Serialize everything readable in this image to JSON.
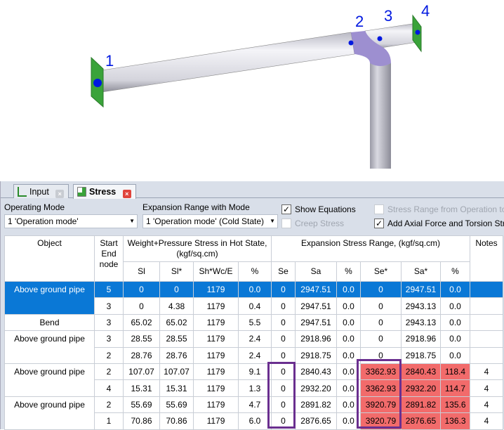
{
  "viewport": {
    "node_labels": [
      "1",
      "2",
      "3",
      "4"
    ]
  },
  "tabs": [
    {
      "label": "Input",
      "active": false
    },
    {
      "label": "Stress",
      "active": true
    }
  ],
  "controls": {
    "operating_mode_label": "Operating Mode",
    "operating_mode_value": "1 'Operation mode'",
    "expansion_label": "Expansion Range with Mode",
    "expansion_value": "1 'Operation mode' (Cold State)",
    "show_equations": {
      "label": "Show Equations",
      "checked": true
    },
    "creep_stress": {
      "label": "Creep Stress",
      "checked": false
    },
    "stress_range": {
      "label": "Stress Range from Operation to",
      "checked": false
    },
    "add_axial": {
      "label": "Add Axial Force and Torsion Stre",
      "checked": true
    }
  },
  "table": {
    "headers": {
      "object": "Object",
      "node": "Start End node",
      "wp": "Weight+Pressure Stress in Hot State, (kgf/sq.cm)",
      "esr": "Expansion Stress Range, (kgf/sq.cm)",
      "notes": "Notes",
      "sub": [
        "Sl",
        "Sl*",
        "Sh*Wc/E",
        "%",
        "Se",
        "Sa",
        "%",
        "Se*",
        "Sa*",
        "%"
      ]
    },
    "groups": [
      {
        "object": "Above ground pipe",
        "selected": true,
        "rows": [
          [
            "5",
            "0",
            "0",
            "1179",
            "0.0",
            "0",
            "2947.51",
            "0.0",
            "0",
            "2947.51",
            "0.0",
            ""
          ],
          [
            "3",
            "0",
            "4.38",
            "1179",
            "0.4",
            "0",
            "2947.51",
            "0.0",
            "0",
            "2943.13",
            "0.0",
            ""
          ]
        ]
      },
      {
        "object": "Bend",
        "rows": [
          [
            "3",
            "65.02",
            "65.02",
            "1179",
            "5.5",
            "0",
            "2947.51",
            "0.0",
            "0",
            "2943.13",
            "0.0",
            ""
          ]
        ]
      },
      {
        "object": "Above ground pipe",
        "rows": [
          [
            "3",
            "28.55",
            "28.55",
            "1179",
            "2.4",
            "0",
            "2918.96",
            "0.0",
            "0",
            "2918.96",
            "0.0",
            ""
          ],
          [
            "2",
            "28.76",
            "28.76",
            "1179",
            "2.4",
            "0",
            "2918.75",
            "0.0",
            "0",
            "2918.75",
            "0.0",
            ""
          ]
        ]
      },
      {
        "object": "Above ground pipe",
        "over": true,
        "rows": [
          [
            "2",
            "107.07",
            "107.07",
            "1179",
            "9.1",
            "0",
            "2840.43",
            "0.0",
            "3362.93",
            "2840.43",
            "118.4",
            "4"
          ],
          [
            "4",
            "15.31",
            "15.31",
            "1179",
            "1.3",
            "0",
            "2932.20",
            "0.0",
            "3362.93",
            "2932.20",
            "114.7",
            "4"
          ]
        ]
      },
      {
        "object": "Above ground pipe",
        "over": true,
        "rows": [
          [
            "2",
            "55.69",
            "55.69",
            "1179",
            "4.7",
            "0",
            "2891.82",
            "0.0",
            "3920.79",
            "2891.82",
            "135.6",
            "4"
          ],
          [
            "1",
            "70.86",
            "70.86",
            "1179",
            "6.0",
            "0",
            "2876.65",
            "0.0",
            "3920.79",
            "2876.65",
            "136.3",
            "4"
          ]
        ]
      }
    ]
  },
  "colors": {
    "selection": "#0a78d6",
    "overstress": "#f26b6b",
    "highlight_box": "#6a2f8f",
    "pipe": "#e4e4ec",
    "bend": "#9d8fd0",
    "support": "#3aa33a",
    "node": "#0018e0"
  }
}
